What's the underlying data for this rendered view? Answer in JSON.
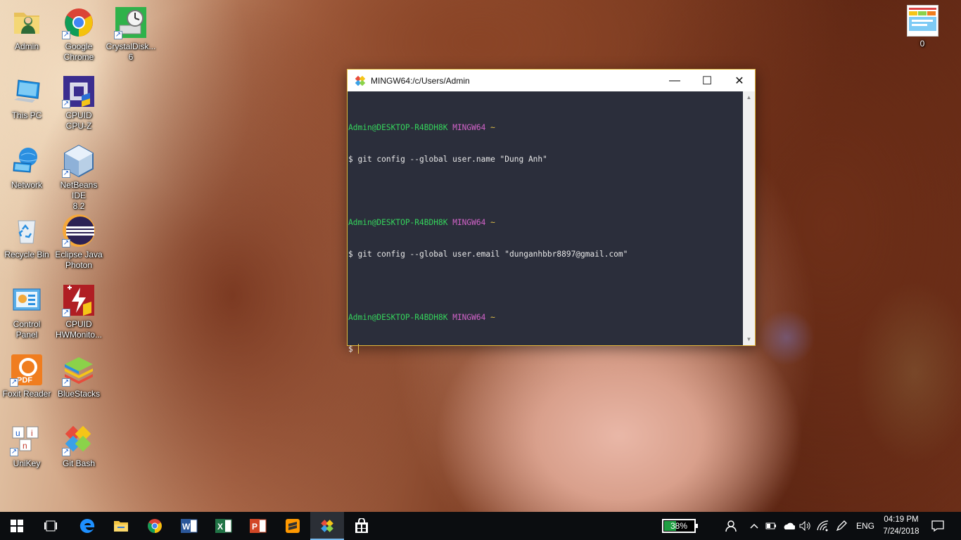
{
  "desktop": {
    "icons": [
      {
        "label": "Admin",
        "icon": "user-folder-icon"
      },
      {
        "label": "Google\nChrome",
        "icon": "chrome-icon"
      },
      {
        "label": "CrystalDisk...\n6",
        "icon": "crystaldisk-icon"
      },
      {
        "label": "This PC",
        "icon": "computer-icon"
      },
      {
        "label": "CPUID\nCPU-Z",
        "icon": "cpuz-icon"
      },
      {
        "label": "Network",
        "icon": "network-icon"
      },
      {
        "label": "NetBeans IDE\n8.2",
        "icon": "netbeans-icon"
      },
      {
        "label": "Recycle Bin",
        "icon": "recycle-bin-icon"
      },
      {
        "label": "Eclipse Java\nPhoton",
        "icon": "eclipse-icon"
      },
      {
        "label": "Control\nPanel",
        "icon": "control-panel-icon"
      },
      {
        "label": "CPUID\nHWMonito...",
        "icon": "hwmonitor-icon"
      },
      {
        "label": "Foxit Reader",
        "icon": "foxit-pdf-icon"
      },
      {
        "label": "BlueStacks",
        "icon": "bluestacks-icon"
      },
      {
        "label": "UniKey",
        "icon": "unikey-icon"
      },
      {
        "label": "Git Bash",
        "icon": "git-bash-icon"
      },
      {
        "label": "0",
        "icon": "image-file-icon"
      }
    ]
  },
  "window": {
    "title": "MINGW64:/c/Users/Admin",
    "buttons": {
      "minimize": "—",
      "maximize": "☐",
      "close": "✕"
    },
    "colors": {
      "border": "#e3b83b",
      "terminal_bg": "#2b2e3b",
      "user": "#35d45c",
      "env": "#d263c9",
      "cursor": "#e5c34a"
    },
    "terminal": {
      "blocks": [
        {
          "user": "Admin@DESKTOP-R4BDH8K",
          "env": "MINGW64",
          "dir": "~",
          "command": "$ git config --global user.name \"Dung Anh\""
        },
        {
          "user": "Admin@DESKTOP-R4BDH8K",
          "env": "MINGW64",
          "dir": "~",
          "command": "$ git config --global user.email \"dunganhbbr8897@gmail.com\""
        },
        {
          "user": "Admin@DESKTOP-R4BDH8K",
          "env": "MINGW64",
          "dir": "~",
          "command": "$"
        }
      ]
    }
  },
  "taskbar": {
    "pinned": [
      {
        "name": "start-button",
        "icon": "windows-logo-icon"
      },
      {
        "name": "task-view-button",
        "icon": "task-view-icon"
      },
      {
        "name": "edge-button",
        "icon": "edge-icon"
      },
      {
        "name": "file-explorer-button",
        "icon": "folder-icon"
      },
      {
        "name": "chrome-button",
        "icon": "chrome-icon"
      },
      {
        "name": "word-button",
        "icon": "word-icon"
      },
      {
        "name": "excel-button",
        "icon": "excel-icon"
      },
      {
        "name": "powerpoint-button",
        "icon": "powerpoint-icon"
      },
      {
        "name": "sublime-button",
        "icon": "sublime-icon"
      },
      {
        "name": "git-bash-button",
        "icon": "git-bash-icon"
      },
      {
        "name": "store-button",
        "icon": "store-icon"
      }
    ],
    "battery_percent": "38%",
    "battery_level": 0.38,
    "language": "ENG",
    "time": "04:19 PM",
    "date": "7/24/2018"
  }
}
